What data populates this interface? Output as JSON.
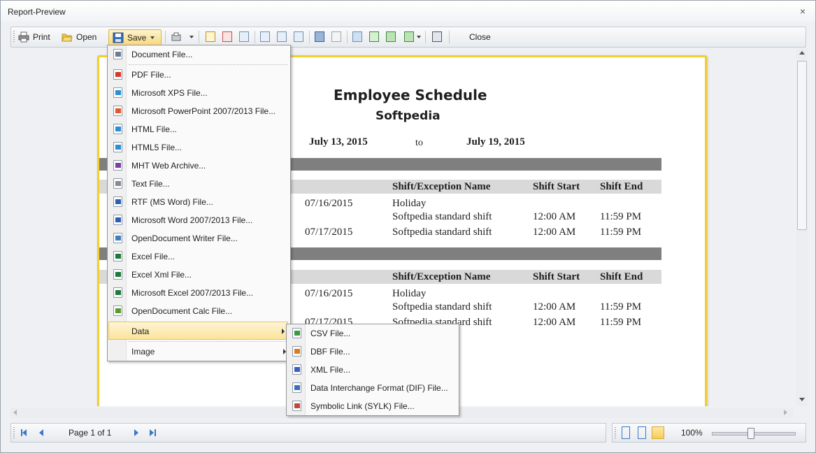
{
  "window": {
    "title": "Report-Preview",
    "close_glyph": "×"
  },
  "toolbar": {
    "print_label": "Print",
    "open_label": "Open",
    "save_label": "Save",
    "close_label": "Close",
    "icons": [
      "print-icon",
      "open-folder-icon",
      "save-disk-icon",
      "export-icon",
      "page-setup-icon",
      "header-footer-icon",
      "scale-icon",
      "parameters-icon",
      "find-icon",
      "watermark-icon",
      "single-page-icon",
      "two-pages-icon",
      "multi-page-icon",
      "email-icon"
    ]
  },
  "report": {
    "title": "Employee Schedule",
    "subtitle": "Softpedia",
    "date_from": "July 13, 2015",
    "date_to_word": "to",
    "date_until": "July 19, 2015",
    "groups": [
      {
        "columns": [
          "Shift/Exception Name",
          "Shift Start",
          "Shift End"
        ],
        "rows": [
          {
            "date": "07/16/2015",
            "name": "Holiday",
            "start": "",
            "end": ""
          },
          {
            "date": "",
            "name": "Softpedia standard shift",
            "start": "12:00 AM",
            "end": "11:59 PM"
          },
          {
            "date": "07/17/2015",
            "name": "Softpedia standard shift",
            "start": "12:00 AM",
            "end": "11:59 PM"
          }
        ]
      },
      {
        "columns": [
          "Shift/Exception Name",
          "Shift Start",
          "Shift End"
        ],
        "rows": [
          {
            "date": "07/16/2015",
            "name": "Holiday",
            "start": "",
            "end": ""
          },
          {
            "date": "",
            "name": "Softpedia standard shift",
            "start": "12:00 AM",
            "end": "11:59 PM"
          },
          {
            "date": "07/17/2015",
            "name": "Softpedia standard shift",
            "start": "12:00 AM",
            "end": "11:59 PM"
          }
        ]
      }
    ]
  },
  "save_menu": {
    "items": [
      {
        "label": "Document File...",
        "icon": "document-file-icon",
        "color": "#6b7c93"
      },
      {
        "label": "PDF File...",
        "icon": "pdf-file-icon",
        "color": "#d23b2b"
      },
      {
        "label": "Microsoft XPS File...",
        "icon": "xps-file-icon",
        "color": "#2a8fd4"
      },
      {
        "label": "Microsoft PowerPoint 2007/2013 File...",
        "icon": "powerpoint-file-icon",
        "color": "#e2572b"
      },
      {
        "label": "HTML File...",
        "icon": "html-file-icon",
        "color": "#2a8fd4"
      },
      {
        "label": "HTML5 File...",
        "icon": "html5-file-icon",
        "color": "#2a8fd4"
      },
      {
        "label": "MHT Web Archive...",
        "icon": "mht-file-icon",
        "color": "#7a3fa3"
      },
      {
        "label": "Text File...",
        "icon": "text-file-icon",
        "color": "#8a8a8a"
      },
      {
        "label": "RTF (MS Word) File...",
        "icon": "rtf-file-icon",
        "color": "#2b5fb4"
      },
      {
        "label": "Microsoft Word 2007/2013 File...",
        "icon": "word-file-icon",
        "color": "#2b5fb4"
      },
      {
        "label": "OpenDocument Writer File...",
        "icon": "odt-file-icon",
        "color": "#3f7fc0"
      },
      {
        "label": "Excel File...",
        "icon": "excel-file-icon",
        "color": "#1f7a3a"
      },
      {
        "label": "Excel Xml File...",
        "icon": "excel-xml-file-icon",
        "color": "#1f7a3a"
      },
      {
        "label": "Microsoft Excel 2007/2013 File...",
        "icon": "excel-2007-file-icon",
        "color": "#1f7a3a"
      },
      {
        "label": "OpenDocument Calc File...",
        "icon": "ods-file-icon",
        "color": "#5a9a2a"
      }
    ],
    "data_label": "Data",
    "image_label": "Image"
  },
  "data_submenu": {
    "items": [
      {
        "label": "CSV File...",
        "icon": "csv-file-icon",
        "color": "#3c9a3c"
      },
      {
        "label": "DBF File...",
        "icon": "dbf-file-icon",
        "color": "#e07a1e"
      },
      {
        "label": "XML File...",
        "icon": "xml-file-icon",
        "color": "#3a5fc0"
      },
      {
        "label": "Data Interchange Format (DIF) File...",
        "icon": "dif-file-icon",
        "color": "#3a6fc0"
      },
      {
        "label": "Symbolic Link (SYLK) File...",
        "icon": "sylk-file-icon",
        "color": "#c04a3a"
      }
    ]
  },
  "status": {
    "page_label": "Page 1 of 1",
    "zoom_label": "100%",
    "zoom_fraction": 0.45
  }
}
